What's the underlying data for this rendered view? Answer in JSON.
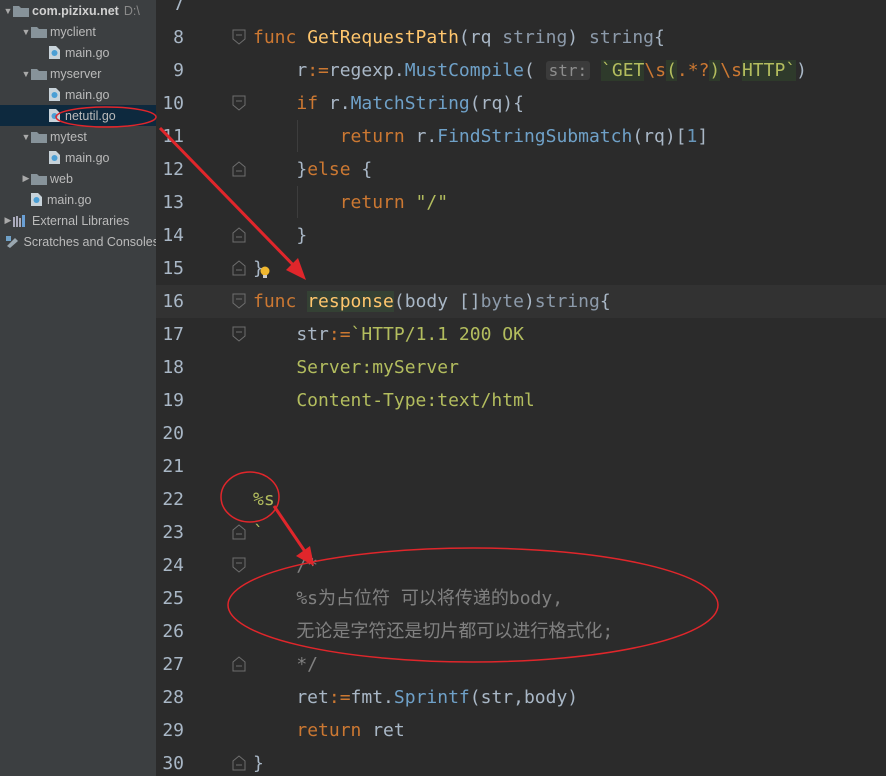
{
  "project_tree": [
    {
      "label": "com.pizixu.net",
      "extra": "D:\\",
      "type": "root",
      "expanded": true,
      "depth": 0
    },
    {
      "label": "myclient",
      "type": "folder",
      "expanded": true,
      "depth": 1
    },
    {
      "label": "main.go",
      "type": "file",
      "depth": 2
    },
    {
      "label": "myserver",
      "type": "folder",
      "expanded": true,
      "depth": 1
    },
    {
      "label": "main.go",
      "type": "file",
      "depth": 2
    },
    {
      "label": "netutil.go",
      "type": "file",
      "depth": 2,
      "selected": true
    },
    {
      "label": "mytest",
      "type": "folder",
      "expanded": true,
      "depth": 1
    },
    {
      "label": "main.go",
      "type": "file",
      "depth": 2
    },
    {
      "label": "web",
      "type": "folder",
      "expanded": false,
      "depth": 1
    },
    {
      "label": "main.go",
      "type": "file",
      "depth": 1
    },
    {
      "label": "External Libraries",
      "type": "lib",
      "expanded": false,
      "depth": 0
    },
    {
      "label": "Scratches and Consoles",
      "type": "scratch",
      "depth": 0
    }
  ],
  "code_lines": [
    {
      "num": "7",
      "segments": []
    },
    {
      "num": "8",
      "segments": [
        {
          "t": "func ",
          "c": "kw"
        },
        {
          "t": "GetRequestPath",
          "c": "fn"
        },
        {
          "t": "(rq ",
          "c": ""
        },
        {
          "t": "string",
          "c": "ty"
        },
        {
          "t": ") ",
          "c": ""
        },
        {
          "t": "string",
          "c": "ty"
        },
        {
          "t": "{",
          "c": ""
        }
      ]
    },
    {
      "num": "9",
      "segments": [
        {
          "t": "    r",
          "c": ""
        },
        {
          "t": ":=",
          "c": "op"
        },
        {
          "t": "regexp.",
          "c": ""
        },
        {
          "t": "MustCompile",
          "c": "mt"
        },
        {
          "t": "( ",
          "c": ""
        },
        {
          "t": "str:",
          "c": "hint"
        },
        {
          "t": " ",
          "c": ""
        },
        {
          "t": "`GET",
          "c": "strhl"
        },
        {
          "t": "\\s",
          "c": "esc"
        },
        {
          "t": "(",
          "c": "strhl"
        },
        {
          "t": ".*?",
          "c": "esc"
        },
        {
          "t": ")",
          "c": "strhl"
        },
        {
          "t": "\\s",
          "c": "esc"
        },
        {
          "t": "HTTP`",
          "c": "strhl"
        },
        {
          "t": ")",
          "c": ""
        }
      ]
    },
    {
      "num": "10",
      "segments": [
        {
          "t": "    ",
          "c": ""
        },
        {
          "t": "if ",
          "c": "kw"
        },
        {
          "t": "r.",
          "c": ""
        },
        {
          "t": "MatchString",
          "c": "mt"
        },
        {
          "t": "(rq){",
          "c": ""
        }
      ]
    },
    {
      "num": "11",
      "segments": [
        {
          "t": "        ",
          "c": ""
        },
        {
          "t": "return ",
          "c": "kw"
        },
        {
          "t": "r.",
          "c": ""
        },
        {
          "t": "FindStringSubmatch",
          "c": "mt"
        },
        {
          "t": "(rq)[",
          "c": ""
        },
        {
          "t": "1",
          "c": "num"
        },
        {
          "t": "]",
          "c": ""
        }
      ]
    },
    {
      "num": "12",
      "segments": [
        {
          "t": "    }",
          "c": ""
        },
        {
          "t": "else ",
          "c": "kw"
        },
        {
          "t": "{",
          "c": ""
        }
      ]
    },
    {
      "num": "13",
      "segments": [
        {
          "t": "        ",
          "c": ""
        },
        {
          "t": "return ",
          "c": "kw"
        },
        {
          "t": "\"/\"",
          "c": "str"
        }
      ]
    },
    {
      "num": "14",
      "segments": [
        {
          "t": "    }",
          "c": ""
        }
      ]
    },
    {
      "num": "15",
      "segments": [
        {
          "t": "}",
          "c": ""
        }
      ]
    },
    {
      "num": "16",
      "segments": [
        {
          "t": "func ",
          "c": "kw"
        },
        {
          "t": "response",
          "c": "fn hl-word"
        },
        {
          "t": "(body []",
          "c": ""
        },
        {
          "t": "byte",
          "c": "ty"
        },
        {
          "t": ")",
          "c": ""
        },
        {
          "t": "string",
          "c": "ty"
        },
        {
          "t": "{",
          "c": ""
        }
      ]
    },
    {
      "num": "17",
      "segments": [
        {
          "t": "    str",
          "c": ""
        },
        {
          "t": ":=",
          "c": "op"
        },
        {
          "t": "`HTTP/1.1 200 OK",
          "c": "str"
        }
      ]
    },
    {
      "num": "18",
      "segments": [
        {
          "t": "    Server:myServer",
          "c": "str"
        }
      ]
    },
    {
      "num": "19",
      "segments": [
        {
          "t": "    Content-Type:text/html",
          "c": "str"
        }
      ]
    },
    {
      "num": "20",
      "segments": []
    },
    {
      "num": "21",
      "segments": []
    },
    {
      "num": "22",
      "segments": [
        {
          "t": "%s",
          "c": "str"
        }
      ]
    },
    {
      "num": "23",
      "segments": [
        {
          "t": "`",
          "c": "str"
        }
      ]
    },
    {
      "num": "24",
      "segments": [
        {
          "t": "    /*",
          "c": "cmt"
        }
      ]
    },
    {
      "num": "25",
      "segments": [
        {
          "t": "    %s为占位符 可以将传递的body,",
          "c": "cmt"
        }
      ]
    },
    {
      "num": "26",
      "segments": [
        {
          "t": "    无论是字符还是切片都可以进行格式化;",
          "c": "cmt"
        }
      ]
    },
    {
      "num": "27",
      "segments": [
        {
          "t": "    */",
          "c": "cmt"
        }
      ]
    },
    {
      "num": "28",
      "segments": [
        {
          "t": "    ret",
          "c": ""
        },
        {
          "t": ":=",
          "c": "op"
        },
        {
          "t": "fmt.",
          "c": ""
        },
        {
          "t": "Sprintf",
          "c": "mt"
        },
        {
          "t": "(str,body)",
          "c": ""
        }
      ]
    },
    {
      "num": "29",
      "segments": [
        {
          "t": "    ",
          "c": ""
        },
        {
          "t": "return ",
          "c": "kw"
        },
        {
          "t": "ret",
          "c": ""
        }
      ]
    },
    {
      "num": "30",
      "segments": [
        {
          "t": "}",
          "c": ""
        }
      ]
    }
  ],
  "colors": {
    "annotation_red": "#e0262b",
    "editor_bg": "#2b2b2b",
    "sidebar_bg": "#3c3f41",
    "keyword": "#cc7832",
    "function": "#ffc66d",
    "string": "#b3bd5e"
  },
  "icons": {
    "folder": "folder-icon",
    "go_file": "go-file-icon",
    "library": "library-icon",
    "scratch": "scratch-icon",
    "intention": "lightbulb-icon"
  }
}
